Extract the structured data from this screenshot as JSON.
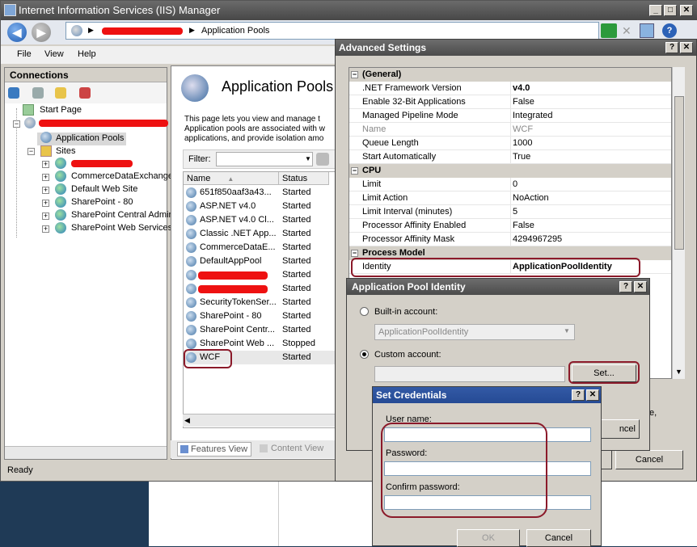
{
  "window": {
    "title": "Internet Information Services (IIS) Manager"
  },
  "address": {
    "crumb": "Application Pools"
  },
  "menu": [
    "File",
    "View",
    "Help"
  ],
  "connections": {
    "header": "Connections",
    "start_page": "Start Page",
    "app_pools": "Application Pools",
    "sites": "Sites",
    "site_items": [
      "CommerceDataExchange",
      "Default Web Site",
      "SharePoint - 80",
      "SharePoint Central Admin",
      "SharePoint Web Services"
    ]
  },
  "center": {
    "title": "Application Pools",
    "description": "This page lets you view and manage the list of application pools on the server. Application pools are associated with worker processes, contain one or more applications, and provide isolation among different applications.",
    "desc_lines": [
      "This page lets you view and manage t",
      "Application pools are associated with w",
      "applications, and provide isolation amo"
    ],
    "filter_label": "Filter:",
    "col_name": "Name",
    "col_status": "Status",
    "rows": [
      {
        "name": "651f850aaf3a43...",
        "status": "Started"
      },
      {
        "name": "ASP.NET v4.0",
        "status": "Started"
      },
      {
        "name": "ASP.NET v4.0 Cl...",
        "status": "Started"
      },
      {
        "name": "Classic .NET App...",
        "status": "Started"
      },
      {
        "name": "CommerceDataE...",
        "status": "Started"
      },
      {
        "name": "DefaultAppPool",
        "status": "Started"
      },
      {
        "name": "",
        "status": "Started"
      },
      {
        "name": "",
        "status": "Started"
      },
      {
        "name": "SecurityTokenSer...",
        "status": "Started"
      },
      {
        "name": "SharePoint - 80",
        "status": "Started"
      },
      {
        "name": "SharePoint Centr...",
        "status": "Started"
      },
      {
        "name": "SharePoint Web ...",
        "status": "Stopped"
      },
      {
        "name": "WCF",
        "status": "Started"
      }
    ],
    "features_view": "Features View",
    "content_view": "Content View"
  },
  "status": "Ready",
  "advanced": {
    "title": "Advanced Settings",
    "cancel": "Cancel",
    "categories": [
      {
        "name": "(General)",
        "props": [
          [
            ".NET Framework Version",
            "v4.0"
          ],
          [
            "Enable 32-Bit Applications",
            "False"
          ],
          [
            "Managed Pipeline Mode",
            "Integrated"
          ],
          [
            "Name",
            "WCF"
          ],
          [
            "Queue Length",
            "1000"
          ],
          [
            "Start Automatically",
            "True"
          ]
        ]
      },
      {
        "name": "CPU",
        "props": [
          [
            "Limit",
            "0"
          ],
          [
            "Limit Action",
            "NoAction"
          ],
          [
            "Limit Interval (minutes)",
            "5"
          ],
          [
            "Processor Affinity Enabled",
            "False"
          ],
          [
            "Processor Affinity Mask",
            "4294967295"
          ]
        ]
      },
      {
        "name": "Process Model",
        "props": [
          [
            "Identity",
            "ApplicationPoolIdentity"
          ]
        ]
      }
    ],
    "side_text": "e,"
  },
  "identity": {
    "title": "Application Pool Identity",
    "builtin_label": "Built-in account:",
    "builtin_value": "ApplicationPoolIdentity",
    "custom_label": "Custom account:",
    "set_button": "Set...",
    "cancel_partial": "ncel"
  },
  "credentials": {
    "title": "Set Credentials",
    "user_label": "User name:",
    "password_label": "Password:",
    "confirm_label": "Confirm password:",
    "ok": "OK",
    "cancel": "Cancel"
  }
}
